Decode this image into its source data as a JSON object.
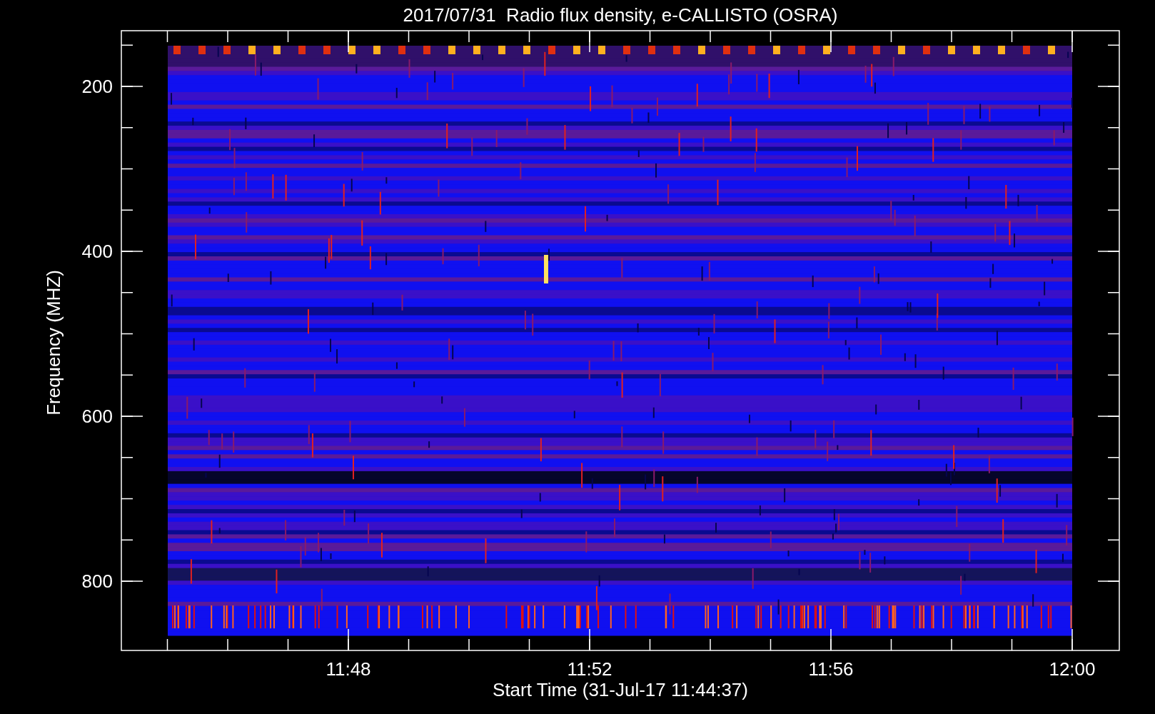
{
  "title": "2017/07/31  Radio flux density, e-CALLISTO (OSRA)",
  "y_axis": {
    "label": "Frequency (MHZ)",
    "ticks": [
      "200",
      "400",
      "600",
      "800"
    ]
  },
  "x_axis": {
    "label": "Start Time (31-Jul-17 11:44:37)",
    "ticks": [
      "11:48",
      "11:52",
      "11:56",
      "12:00"
    ]
  }
}
